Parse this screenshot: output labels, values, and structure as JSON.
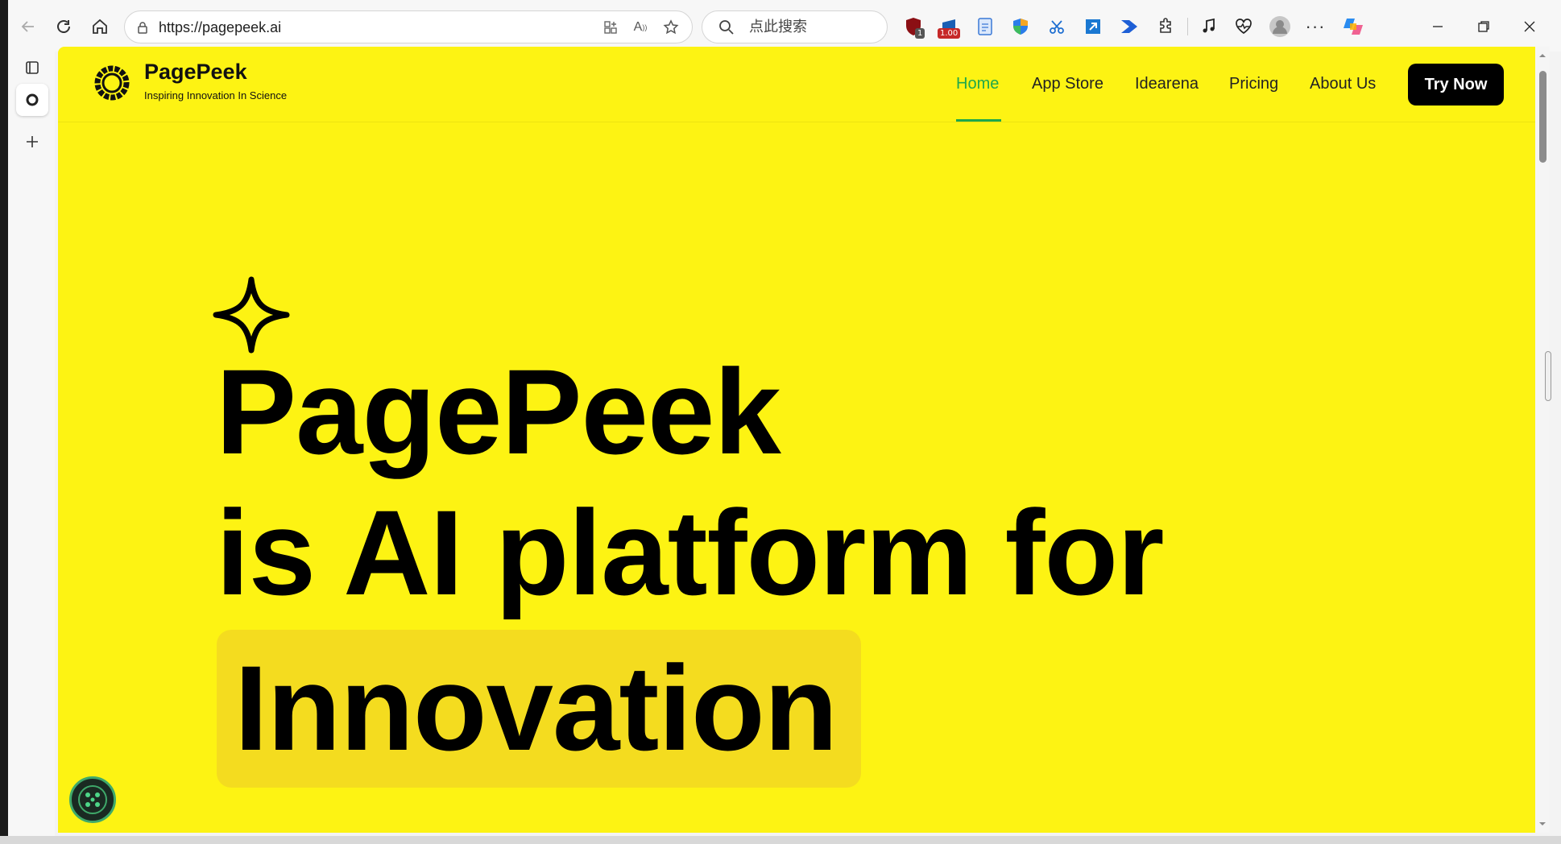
{
  "browser": {
    "url": "https://pagepeek.ai",
    "search_placeholder": "点此搜索",
    "extension_badges": {
      "shield": "1",
      "counter": "1.00"
    }
  },
  "site": {
    "brand": "PagePeek",
    "tagline": "Inspiring Innovation In Science",
    "nav": [
      "Home",
      "App Store",
      "Idearena",
      "Pricing",
      "About Us"
    ],
    "cta": "Try Now",
    "accent_color": "#1fa84b",
    "background_color": "#fdf313"
  },
  "hero": {
    "line1": "PagePeek",
    "line2": "is AI platform for",
    "line3": "Innovation"
  }
}
